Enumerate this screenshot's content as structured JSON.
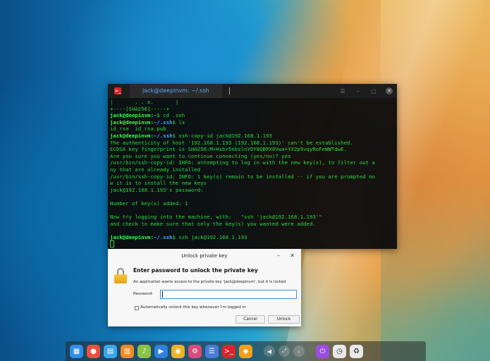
{
  "terminal": {
    "tab_title": "jack@deepinvm: ~/.ssh",
    "app_icon_glyph": ">_",
    "tab_sep": "|",
    "lines": [
      {
        "text": "|       . . o.       |"
      },
      {
        "text": "+----[SHA256]-----+"
      },
      {
        "prompt": "jack@deepinvm",
        "path": "~",
        "cmd": "$ cd .ssh"
      },
      {
        "prompt": "jack@deepinvm",
        "path": "~/.ssh",
        "cmd": "$ ls"
      },
      {
        "text": "id_rsa  id_rsa.pub"
      },
      {
        "prompt": "jack@deepinvm",
        "path": "~/.ssh",
        "cmd": "$ ssh-copy-id jack@192.168.1.193"
      },
      {
        "text": "The authenticity of host '192.168.1.193 (192.168.1.193)' can't be established."
      },
      {
        "text": "ECDSA key fingerprint is SHA256:M+Hsbr5nbslnYDY8QBPX0Vwa+YX2p9vqyRoFeWWTdwE."
      },
      {
        "text": "Are you sure you want to continue connecting (yes/no)? yes"
      },
      {
        "text": "/usr/bin/ssh-copy-id: INFO: attempting to log in with the new key(s), to filter out a"
      },
      {
        "text": "ny that are already installed"
      },
      {
        "text": "/usr/bin/ssh-copy-id: INFO: 1 key(s) remain to be installed -- if you are prompted no"
      },
      {
        "text": "w it is to install the new keys"
      },
      {
        "text": "jack@192.168.1.193's password:"
      },
      {
        "text": ""
      },
      {
        "text": "Number of key(s) added: 1"
      },
      {
        "text": ""
      },
      {
        "text": "Now try logging into the machine, with:   \"ssh 'jack@192.168.1.193'\""
      },
      {
        "text": "and check to make sure that only the key(s) you wanted were added."
      },
      {
        "text": ""
      },
      {
        "prompt": "jack@deepinvm",
        "path": "~/.ssh",
        "cmd": "$ ssh jack@192.168.1.193"
      }
    ]
  },
  "dialog": {
    "title": "Unlock private key",
    "heading": "Enter password to unlock the private key",
    "description": "An application wants access to the private key 'jack@deepinvm', but it is locked",
    "password_label": "Password:",
    "password_value": "",
    "auto_unlock_label": "Automatically unlock this key whenever I'm logged in",
    "auto_unlock_checked": false,
    "cancel_label": "Cancel",
    "unlock_label": "Unlock",
    "minimize_glyph": "–",
    "close_glyph": "✕"
  },
  "dock": {
    "items": [
      {
        "name": "launcher-icon",
        "glyph": "▦",
        "color": "#2f8fe8"
      },
      {
        "name": "screen-recorder-icon",
        "glyph": "●",
        "color": "#e8523f"
      },
      {
        "name": "app-store-icon",
        "glyph": "▤",
        "color": "#3aa7e8"
      },
      {
        "name": "file-manager-icon",
        "glyph": "▥",
        "color": "#f08a24"
      },
      {
        "name": "music-icon",
        "glyph": "♪",
        "color": "#8bc34a"
      },
      {
        "name": "video-player-icon",
        "glyph": "▶",
        "color": "#2f7fe0"
      },
      {
        "name": "chrome-icon",
        "glyph": "◉",
        "color": "#e9b32a"
      },
      {
        "name": "settings-icon",
        "glyph": "⚙",
        "color": "#d94b7a"
      },
      {
        "name": "text-editor-icon",
        "glyph": "☰",
        "color": "#4a7bd9"
      },
      {
        "name": "terminal-icon",
        "glyph": ">_",
        "color": "#d8252d"
      },
      {
        "name": "security-icon",
        "glyph": "◆",
        "color": "#f0a020"
      }
    ],
    "tray": [
      {
        "name": "volume-icon",
        "glyph": "◀"
      },
      {
        "name": "network-icon",
        "glyph": "⤢"
      },
      {
        "name": "collapse-arrow-icon",
        "glyph": "‹"
      }
    ],
    "right": [
      {
        "name": "power-icon",
        "glyph": "⏻",
        "color": "#9b4de0"
      },
      {
        "name": "clock-icon",
        "glyph": "◷",
        "color": "#e8e8e8"
      },
      {
        "name": "trash-icon",
        "glyph": "♻",
        "color": "#e8e8e8"
      }
    ]
  }
}
